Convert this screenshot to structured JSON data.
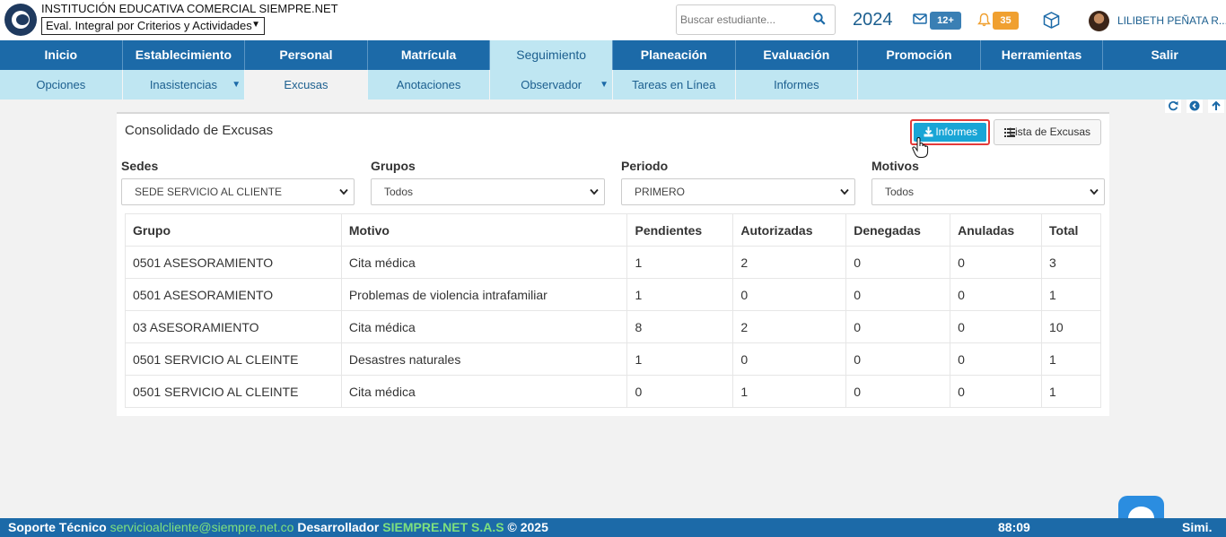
{
  "header": {
    "institution": "INSTITUCIÓN EDUCATIVA COMERCIAL SIEMPRE.NET",
    "selected_program": "Eval. Integral por Criterios y Actividades",
    "search_placeholder": "Buscar estudiante...",
    "year": "2024",
    "mail_badge": "12+",
    "bell_badge": "35",
    "user_name": "LILIBETH PEÑATA R..."
  },
  "main_nav": [
    {
      "label": "Inicio"
    },
    {
      "label": "Establecimiento"
    },
    {
      "label": "Personal"
    },
    {
      "label": "Matrícula"
    },
    {
      "label": "Seguimiento"
    },
    {
      "label": "Planeación"
    },
    {
      "label": "Evaluación"
    },
    {
      "label": "Promoción"
    },
    {
      "label": "Herramientas"
    },
    {
      "label": "Salir"
    }
  ],
  "sub_nav": [
    {
      "label": "Opciones"
    },
    {
      "label": "Inasistencias"
    },
    {
      "label": "Excusas"
    },
    {
      "label": "Anotaciones"
    },
    {
      "label": "Observador"
    },
    {
      "label": "Tareas en Línea"
    },
    {
      "label": "Informes"
    }
  ],
  "panel": {
    "title": "Consolidado de Excusas",
    "informes_button": "Informes",
    "lista_button": "Lista de Excusas"
  },
  "filters": {
    "sedes": {
      "label": "Sedes",
      "value": "SEDE SERVICIO AL CLIENTE"
    },
    "grupos": {
      "label": "Grupos",
      "value": "Todos"
    },
    "periodo": {
      "label": "Periodo",
      "value": "PRIMERO"
    },
    "motivos": {
      "label": "Motivos",
      "value": "Todos"
    }
  },
  "table": {
    "headers": [
      "Grupo",
      "Motivo",
      "Pendientes",
      "Autorizadas",
      "Denegadas",
      "Anuladas",
      "Total"
    ],
    "rows": [
      [
        "0501 ASESORAMIENTO",
        "Cita médica",
        "1",
        "2",
        "0",
        "0",
        "3"
      ],
      [
        "0501 ASESORAMIENTO",
        "Problemas de violencia intrafamiliar",
        "1",
        "0",
        "0",
        "0",
        "1"
      ],
      [
        "03 ASESORAMIENTO",
        "Cita médica",
        "8",
        "2",
        "0",
        "0",
        "10"
      ],
      [
        "0501 SERVICIO AL CLEINTE",
        "Desastres naturales",
        "1",
        "0",
        "0",
        "0",
        "1"
      ],
      [
        "0501 SERVICIO AL CLEINTE",
        "Cita médica",
        "0",
        "1",
        "0",
        "0",
        "1"
      ]
    ]
  },
  "footer": {
    "support_label": "Soporte Técnico",
    "support_email": "servicioalcliente@siempre.net.co",
    "developer_label": "Desarrollador",
    "developer_name": "SIEMPRE.NET S.A.S",
    "copyright": "© 2025",
    "time": "88:09",
    "brand": "Simi."
  },
  "colors": {
    "primary": "#1c6aa8",
    "subnav": "#bfe6f2",
    "informes_button": "#19a5d6",
    "highlight_border": "#e43a3a",
    "mail_badge": "#3a7fb4",
    "bell_badge": "#f0a030"
  },
  "icons": [
    "search-icon",
    "mail-icon",
    "bell-icon",
    "cube-icon",
    "refresh-icon",
    "back-icon",
    "up-icon",
    "download-icon",
    "list-icon",
    "chevron-down-icon",
    "hand-cursor-icon",
    "chat-icon"
  ]
}
